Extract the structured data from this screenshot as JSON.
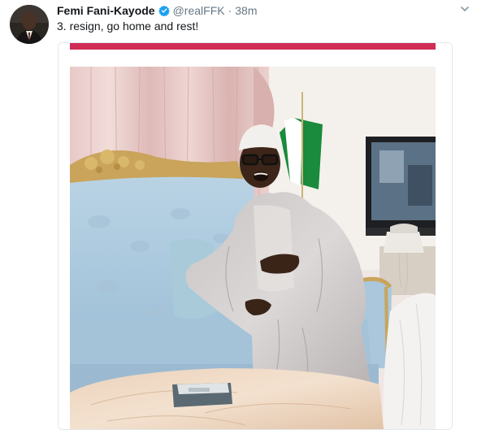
{
  "tweet": {
    "display_name": "Femi Fani-Kayode",
    "handle": "@realFFK",
    "separator": "·",
    "time": "38m",
    "text": "3. resign, go home and rest!"
  },
  "icons": {
    "verified": "verified-badge-icon",
    "caret": "chevron-down-icon"
  },
  "colors": {
    "verified_blue": "#1da1f2",
    "muted": "#657786",
    "text": "#14171a",
    "border": "#e1e8ed"
  }
}
